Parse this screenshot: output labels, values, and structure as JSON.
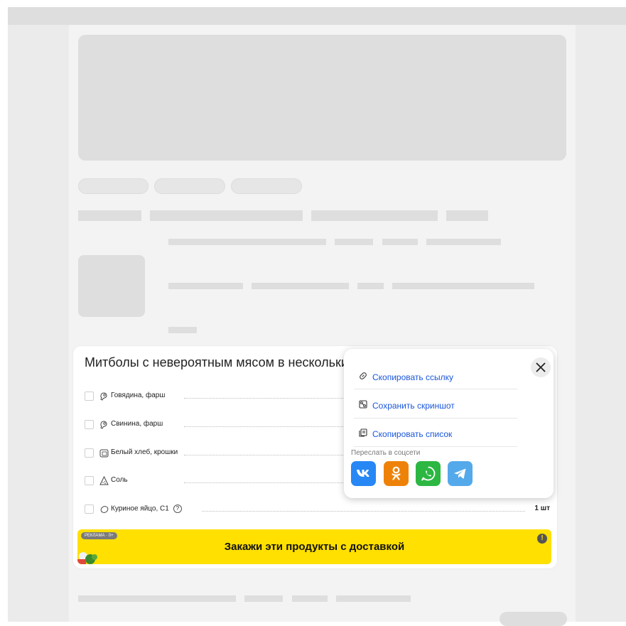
{
  "recipe": {
    "title": "Митболы с невероятным мясом в нескольких",
    "ingredients": [
      {
        "name": "Говядина, фарш",
        "icon": "meat-icon"
      },
      {
        "name": "Свинина, фарш",
        "icon": "meat-icon"
      },
      {
        "name": "Белый хлеб, крошки",
        "icon": "bread-icon"
      },
      {
        "name": "Соль",
        "icon": "salt-icon"
      },
      {
        "name": "Куриное яйцо, С1",
        "icon": "egg-icon",
        "help": "?",
        "qty": "1 шт"
      }
    ]
  },
  "ad": {
    "badge": "РЕКЛАМА · 0+",
    "text": "Закажи эти продукты с доставкой",
    "info": "!",
    "color": "#ffe000"
  },
  "share_menu": {
    "items": [
      {
        "label": "Скопировать ссылку",
        "icon": "link-icon"
      },
      {
        "label": "Сохранить скриншот",
        "icon": "screenshot-icon"
      },
      {
        "label": "Скопировать список",
        "icon": "copy-icon"
      }
    ],
    "social_label": "Переслать в соцсети",
    "social": [
      {
        "name": "vk",
        "icon": "vk-icon",
        "color": "#2787f5"
      },
      {
        "name": "odnoklassniki",
        "icon": "ok-icon",
        "color": "#ee8208"
      },
      {
        "name": "whatsapp",
        "icon": "whatsapp-icon",
        "color": "#2cb742"
      },
      {
        "name": "telegram",
        "icon": "telegram-icon",
        "color": "#54a9eb"
      }
    ]
  },
  "colors": {
    "link": "#1a56db",
    "skeleton": "#dedede",
    "background": "#ebebeb"
  }
}
